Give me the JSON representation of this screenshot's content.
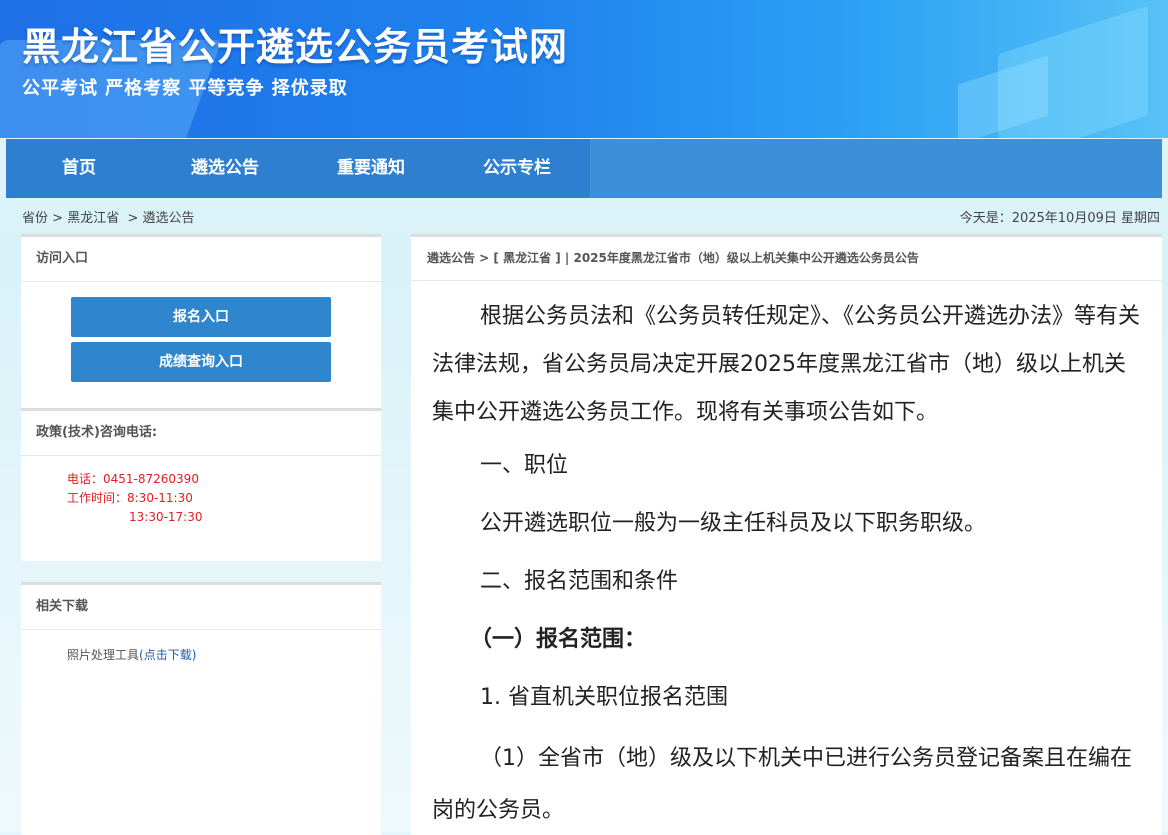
{
  "header": {
    "title": "黑龙江省公开遴选公务员考试网",
    "slogan": "公平考试 严格考察 平等竞争 择优录取"
  },
  "nav": {
    "items": [
      "首页",
      "遴选公告",
      "重要通知",
      "公示专栏"
    ]
  },
  "breadcrumb": {
    "part1": "省份",
    "sep1": " > ",
    "part2": "黑龙江省",
    "sep2": "  > ",
    "part3": "遴选公告"
  },
  "today": "今天是：2025年10月09日 星期四",
  "sidebar": {
    "access": {
      "title": "访问入口",
      "buttons": [
        "报名入口",
        "成绩查询入口"
      ]
    },
    "consult": {
      "title": "政策(技术)咨询电话:",
      "phone": "电话：0451-87260390",
      "hours1": "工作时间：8:30-11:30",
      "hours2": "13:30-17:30"
    },
    "downloads": {
      "title": "相关下载",
      "item_text": "照片处理工具",
      "item_link": "(点击下载)"
    }
  },
  "article": {
    "breadcrumb": "遴选公告 > [ 黑龙江省 ] | 2025年度黑龙江省市（地）级以上机关集中公开遴选公务员公告",
    "paragraphs": [
      "根据公务员法和《公务员转任规定》、《公务员公开遴选办法》等有关法律法规，省公务员局决定开展2025年度黑龙江省市（地）级以上机关集中公开遴选公务员工作。现将有关事项公告如下。",
      "一、职位",
      "公开遴选职位一般为一级主任科员及以下职务职级。",
      "二、报名范围和条件",
      "（一）报名范围：",
      "1. 省直机关职位报名范围",
      "（1）全省市（地）级及以下机关中已进行公务员登记备案且在编在岗的公务员。"
    ]
  }
}
